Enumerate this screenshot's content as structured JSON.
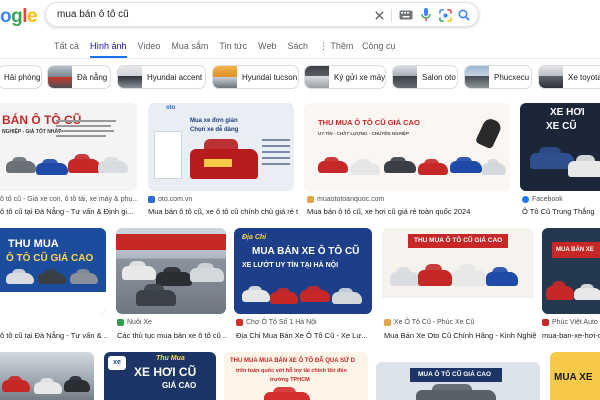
{
  "logo": {
    "letters": [
      {
        "ch": "o",
        "color": "#4285f4"
      },
      {
        "ch": "g",
        "color": "#34a853"
      },
      {
        "ch": "l",
        "color": "#ea4335"
      },
      {
        "ch": "e",
        "color": "#fbbc05"
      }
    ]
  },
  "search": {
    "query": "mua bán ô tô cũ"
  },
  "tabs": [
    {
      "label": "Tất cả"
    },
    {
      "label": "Hình ảnh"
    },
    {
      "label": "Video"
    },
    {
      "label": "Mua sắm"
    },
    {
      "label": "Tin tức"
    },
    {
      "label": "Web"
    },
    {
      "label": "Sách"
    },
    {
      "label": "⋮ Thêm"
    }
  ],
  "tools_label": "Công cụ",
  "chips": [
    "Hải phòng",
    "Đà nẵng",
    "Hyundai accent",
    "Hyundai tucson",
    "Ký gửi xe máy",
    "Salon oto",
    "Phucxecu",
    "Xe toyota"
  ],
  "results": {
    "r1": {
      "source": "oto.com.vn",
      "title": "Mua bán ô tô cũ, xe ô tô cũ chính chủ giá rẻ tr...",
      "banner_lines": [
        "Mua xe đơn giản",
        "Chọn xe dễ dàng"
      ]
    },
    "r0": {
      "source": "ô tô cũ - Giá xe con, ô tô tải, xe máy & phụ...",
      "title": "ô tô cũ tại Đà Nẵng - Tư vấn & Định gi...",
      "banner_lines": [
        "BÁN Ô TÔ CŨ",
        "NGHIỆP - GIÁ TỐT NHẤT"
      ]
    },
    "r2": {
      "source": "muaototoanquoc.com",
      "title": "Mua bán ô tô cũ, xe hơi cũ giá rẻ toàn quốc 2024",
      "banner_lines": [
        "THU MUA Ô TÔ CŨ GIÁ CAO",
        "UY TÍN - CHẤT LƯỢNG - CHUYÊN NGHIỆP"
      ]
    },
    "r3": {
      "source": "Facebook",
      "title": "Ô Tô Cũ Trung Thắng",
      "banner_lines": [
        "XE HƠI",
        "XE CŨ"
      ]
    },
    "r4": {
      "source": "",
      "title": "ô tô cũ tại Đà Nẵng - Tư vấn & ...",
      "banner_lines": [
        "THU MUA",
        "Ô TÔ CŨ GIÁ CAO"
      ]
    },
    "r5": {
      "source": "Nuôi Xe",
      "title": "Các thủ tục mua bán xe ô tô cũ ..."
    },
    "r6": {
      "source": "Chợ Ô Tô Số 1 Hà Nội",
      "title": "Địa Chỉ Mua Bán Xe Ô Tô Cũ - Xe Lư...",
      "banner_lines": [
        "Địa Chỉ",
        "MUA BÁN XE Ô TÔ CŨ",
        "XE LƯỚT UY TÍN TẠI HÀ NỘI"
      ]
    },
    "r7": {
      "source": "Xe Ô Tô Cũ - Phúc Xe Cũ",
      "title": "Mua Bán Xe Oto Cũ Chính Hãng - Kinh Nghiệ...",
      "banner_lines": [
        "THU MUA Ô TÔ CŨ GIÁ CAO"
      ]
    },
    "r8": {
      "source": "Phúc Việt Auto",
      "title": "mua-ban-xe-hơi-cũ",
      "banner_lines": [
        "MUA BÁN XE"
      ]
    },
    "r10": {
      "banner_lines": [
        "Thu Mua",
        "XE HƠI CŨ",
        "GIÁ CAO"
      ]
    },
    "r11": {
      "banner_lines": [
        "THU MUA MUA BÁN XE Ô TÔ ĐÃ QUA SỬ D",
        "trên toàn quốc với hỗ trợ tài chính lên đến",
        "trường TPHCM"
      ]
    },
    "r12": {
      "banner_lines": [
        "MUA Ô TÔ CŨ GIÁ CAO"
      ]
    },
    "r13": {
      "banner_lines": [
        "MUA XE"
      ]
    }
  }
}
